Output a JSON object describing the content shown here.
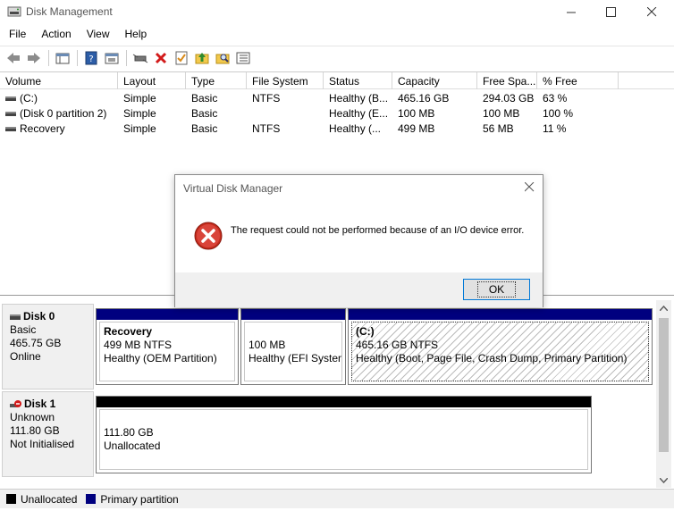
{
  "window": {
    "title": "Disk Management"
  },
  "menu": [
    "File",
    "Action",
    "View",
    "Help"
  ],
  "table": {
    "columns": [
      "Volume",
      "Layout",
      "Type",
      "File System",
      "Status",
      "Capacity",
      "Free Spa...",
      "% Free"
    ],
    "rows": [
      [
        "(C:)",
        "Simple",
        "Basic",
        "NTFS",
        "Healthy (B...",
        "465.16 GB",
        "294.03 GB",
        "63 %"
      ],
      [
        "(Disk 0 partition 2)",
        "Simple",
        "Basic",
        "",
        "Healthy (E...",
        "100 MB",
        "100 MB",
        "100 %"
      ],
      [
        "Recovery",
        "Simple",
        "Basic",
        "NTFS",
        "Healthy (...",
        "499 MB",
        "56 MB",
        "11 %"
      ]
    ]
  },
  "disks": [
    {
      "name": "Disk 0",
      "type": "Basic",
      "size": "465.75 GB",
      "status": "Online",
      "partitions": [
        {
          "name": "Recovery",
          "size": "499 MB NTFS",
          "status": "Healthy (OEM Partition)"
        },
        {
          "name": "",
          "size": "100 MB",
          "status": "Healthy (EFI System"
        },
        {
          "name": "(C:)",
          "size": "465.16 GB NTFS",
          "status": "Healthy (Boot, Page File, Crash Dump, Primary Partition)"
        }
      ]
    },
    {
      "name": "Disk 1",
      "type": "Unknown",
      "size": "111.80 GB",
      "status": "Not Initialised",
      "partitions": [
        {
          "name": "",
          "size": "111.80 GB",
          "status": "Unallocated"
        }
      ]
    }
  ],
  "legend": [
    {
      "label": "Unallocated",
      "color": "#000000"
    },
    {
      "label": "Primary partition",
      "color": "#00007f"
    }
  ],
  "dialog": {
    "title": "Virtual Disk Manager",
    "message": "The request could not be performed because of an I/O device error.",
    "ok_label": "OK",
    "icon": "error-icon"
  },
  "colors": {
    "primary_partition": "#00007f",
    "unallocated": "#000000",
    "accent": "#0078d7"
  }
}
